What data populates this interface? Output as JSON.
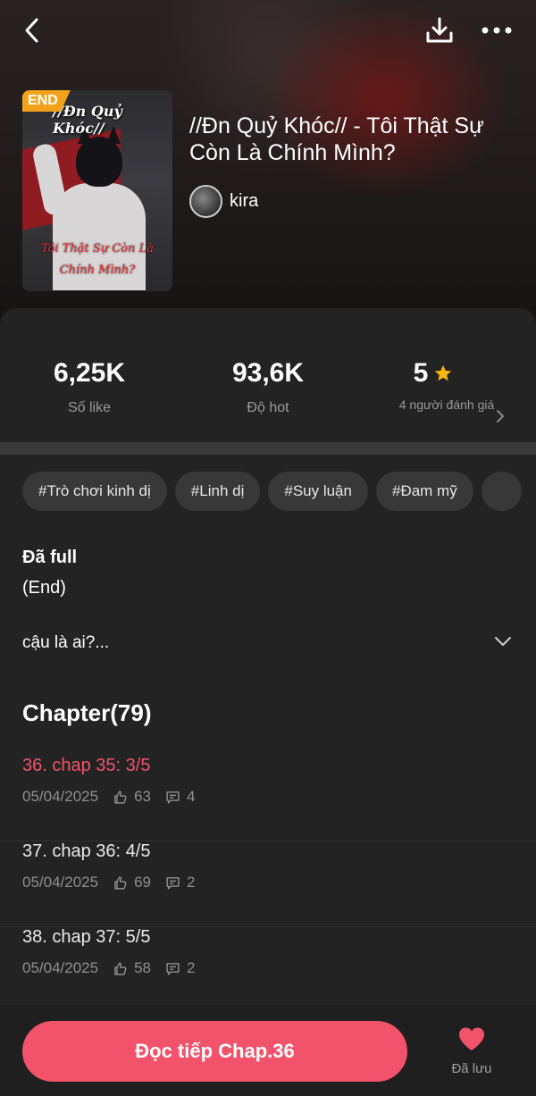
{
  "header": {
    "back_icon": "chevron-left-icon",
    "download_icon": "download-icon",
    "more_icon": "more-horizontal-icon"
  },
  "story": {
    "badge": "END",
    "cover_title": "//Đn Quỷ Khóc//",
    "cover_subtitle": "Tôi Thật Sự Còn Là Chính Mình?",
    "title": "//Đn Quỷ Khóc// - Tôi Thật Sự Còn Là Chính Mình?",
    "author": "kira"
  },
  "stats": {
    "likes_value": "6,25K",
    "likes_label": "Số like",
    "hot_value": "93,6K",
    "hot_label": "Độ hot",
    "rating_value": "5",
    "rating_label": "4 người đánh giá"
  },
  "tags": [
    "#Trò chơi kinh dị",
    "#Linh dị",
    "#Suy luận",
    "#Đam mỹ"
  ],
  "status": {
    "line1": "Đã full",
    "line2": "(End)"
  },
  "description": {
    "text": "cậu là ai?..."
  },
  "chapters": {
    "heading": "Chapter(79)",
    "items": [
      {
        "title": "36. chap 35: 3/5",
        "date": "05/04/2025",
        "likes": "63",
        "comments": "4"
      },
      {
        "title": "37. chap 36: 4/5",
        "date": "05/04/2025",
        "likes": "69",
        "comments": "2"
      },
      {
        "title": "38. chap 37: 5/5",
        "date": "05/04/2025",
        "likes": "58",
        "comments": "2"
      }
    ]
  },
  "bottom": {
    "read_label": "Đọc tiếp Chap.36",
    "saved_label": "Đã lưu"
  },
  "colors": {
    "accent": "#f2536b",
    "badge": "#f2a31b",
    "star": "#f5b70a"
  }
}
